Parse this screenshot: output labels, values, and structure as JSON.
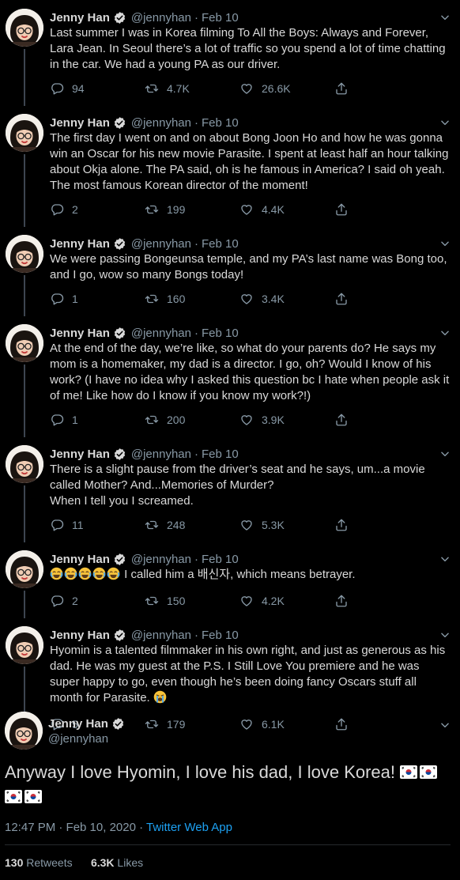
{
  "colors": {
    "background": "#000000",
    "text": "#d9d9d9",
    "muted": "#8899a6",
    "accent": "#1da1f2",
    "divider": "#26292d",
    "thread_line": "#3d4550"
  },
  "author": {
    "name": "Jenny Han",
    "handle": "@jennyhan"
  },
  "tweets": [
    {
      "date": "Feb 10",
      "text": "Last summer I was in Korea filming To All the Boys: Always and Forever, Lara Jean. In Seoul there’s a lot of traffic so you spend a lot of time chatting in the car. We had a young PA as our driver.",
      "replies": "94",
      "retweets": "4.7K",
      "likes": "26.6K"
    },
    {
      "date": "Feb 10",
      "text": "The first day I went on and on about Bong Joon Ho and how he was gonna win an Oscar for his new movie Parasite. I spent at least half an hour talking about Okja alone. The PA said, oh is he famous in America? I said oh yeah. The most famous Korean director of the moment!",
      "replies": "2",
      "retweets": "199",
      "likes": "4.4K"
    },
    {
      "date": "Feb 10",
      "text": "We were passing Bongeunsa temple, and my PA’s last name was Bong too, and I go, wow so many Bongs today!",
      "replies": "1",
      "retweets": "160",
      "likes": "3.4K"
    },
    {
      "date": "Feb 10",
      "text": "At the end of the day, we’re like, so what do your parents do? He says my mom is a homemaker, my dad is a director. I go, oh? Would I know of his work? (I have no idea why I asked this question bc I hate when people ask it of me! Like how do I know if you know my work?!)",
      "replies": "1",
      "retweets": "200",
      "likes": "3.9K"
    },
    {
      "date": "Feb 10",
      "text": "There is a slight pause from the driver’s seat and he says, um...a movie called Mother? And...Memories of Murder?\nWhen I tell you I screamed.",
      "replies": "11",
      "retweets": "248",
      "likes": "5.3K"
    },
    {
      "date": "Feb 10",
      "emoji_prefix_count": 5,
      "text": " I called him a 배신자, which means betrayer.",
      "replies": "2",
      "retweets": "150",
      "likes": "4.2K"
    },
    {
      "date": "Feb 10",
      "text": "Hyomin is a talented filmmaker in his own right, and just as generous as his dad. He was my guest at the P.S. I Still Love You premiere and he was super happy to go, even though he’s been doing fancy Oscars stuff all month for Parasite. ",
      "emoji_suffix": "crying-emoji",
      "replies": "5",
      "retweets": "179",
      "likes": "6.1K"
    }
  ],
  "main_tweet": {
    "text": "Anyway I love Hyomin, I love his dad, I love Korea! ",
    "flags": 4,
    "time": "12:47 PM · Feb 10, 2020 · ",
    "app": "Twitter Web App",
    "retweets_count": "130",
    "retweets_label": "Retweets",
    "likes_count": "6.3K",
    "likes_label": "Likes"
  },
  "icons": {
    "reply": "reply-icon",
    "retweet": "retweet-icon",
    "like": "heart-icon",
    "share": "share-icon",
    "verified": "verified-badge-icon",
    "caret": "chevron-down-icon",
    "flag": "south-korea-flag-icon",
    "emoji": "tears-of-joy-emoji"
  }
}
